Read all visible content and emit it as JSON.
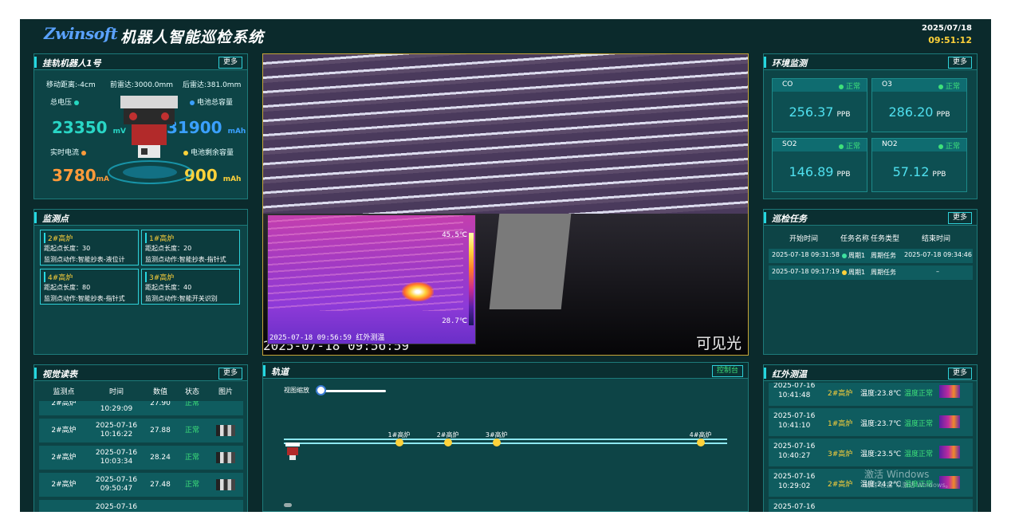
{
  "header": {
    "logo": "Zwinsoft",
    "title": "机器人智能巡检系统",
    "date": "2025/07/18",
    "time": "09:51:12"
  },
  "more_label": "更多",
  "robot": {
    "title": "挂轨机器人1号",
    "move": "移动距离:-4cm",
    "front": "前雷达:3000.0mm",
    "back": "后雷达:381.0mm",
    "voltage_label": "总电压",
    "voltage_value": "23350",
    "voltage_unit": "mV",
    "capacity_label": "电池总容量",
    "capacity_value": "31900",
    "capacity_unit": "mAh",
    "current_label": "实时电流",
    "current_value": "3780",
    "current_unit": "mA",
    "remain_label": "电池剩余容量",
    "remain_value": "900",
    "remain_unit": "mAh"
  },
  "monitor": {
    "title": "监测点",
    "points": [
      {
        "name": "2#高炉",
        "dist": "距起点长度：30",
        "action": "监测点动作:智能抄表-液位计"
      },
      {
        "name": "1#高炉",
        "dist": "距起点长度：20",
        "action": "监测点动作:智能抄表-指针式"
      },
      {
        "name": "4#高炉",
        "dist": "距起点长度：80",
        "action": "监测点动作:智能抄表-指针式"
      },
      {
        "name": "3#高炉",
        "dist": "距起点长度：40",
        "action": "监测点动作:智能开关识别"
      }
    ]
  },
  "visual": {
    "title": "视觉读表",
    "headers": [
      "监测点",
      "时间",
      "数值",
      "状态",
      "图片"
    ],
    "partial_top": {
      "name": "2#高炉",
      "time": "10:29:09",
      "value": "27.90",
      "status": "正常"
    },
    "rows": [
      {
        "name": "2#高炉",
        "date": "2025-07-16",
        "time": "10:16:22",
        "value": "27.88",
        "status": "正常"
      },
      {
        "name": "2#高炉",
        "date": "2025-07-16",
        "time": "10:03:34",
        "value": "28.24",
        "status": "正常"
      },
      {
        "name": "2#高炉",
        "date": "2025-07-16",
        "time": "09:50:47",
        "value": "27.48",
        "status": "正常"
      }
    ],
    "partial_bottom": {
      "date": "2025-07-16"
    }
  },
  "video": {
    "timestamp": "2025-07-18 09:56:59",
    "label": "可见光",
    "ir_timestamp": "2025-07-18 09:56:59",
    "ir_label": "红外测温",
    "ir_max": "45.5℃",
    "ir_min": "28.7℃"
  },
  "track": {
    "title": "轨道",
    "control": "控制台",
    "zoom_label": "视图缩放",
    "zoom_level": 0.05,
    "points": [
      {
        "name": "1#高炉",
        "pos": 0.26
      },
      {
        "name": "2#高炉",
        "pos": 0.37
      },
      {
        "name": "3#高炉",
        "pos": 0.48
      },
      {
        "name": "4#高炉",
        "pos": 0.94
      }
    ]
  },
  "env": {
    "title": "环境监测",
    "cards": [
      {
        "name": "CO",
        "status": "正常",
        "value": "256.37",
        "unit": "PPB"
      },
      {
        "name": "O3",
        "status": "正常",
        "value": "286.20",
        "unit": "PPB"
      },
      {
        "name": "SO2",
        "status": "正常",
        "value": "146.89",
        "unit": "PPB"
      },
      {
        "name": "NO2",
        "status": "正常",
        "value": "57.12",
        "unit": "PPB"
      }
    ]
  },
  "tasks": {
    "title": "巡检任务",
    "headers": [
      "开始时间",
      "任务名称",
      "任务类型",
      "结束时间"
    ],
    "rows": [
      {
        "start": "2025-07-18 09:31:58",
        "name": "周期1",
        "type": "周期任务",
        "end": "2025-07-18 09:34:46",
        "dot": "#3ee0a0"
      },
      {
        "start": "2025-07-18 09:17:19",
        "name": "周期1",
        "type": "周期任务",
        "end": "–",
        "dot": "#ffd23a"
      }
    ]
  },
  "ir": {
    "title": "红外测温",
    "partial_top": {
      "date": "2025-07-16",
      "time": "10:41:48",
      "name": "2#高炉",
      "temp": "温度:23.8℃",
      "status": "温度正常"
    },
    "rows": [
      {
        "date": "2025-07-16",
        "time": "10:41:10",
        "name": "1#高炉",
        "temp": "温度:23.7℃",
        "status": "温度正常"
      },
      {
        "date": "2025-07-16",
        "time": "10:40:27",
        "name": "3#高炉",
        "temp": "温度:23.5℃",
        "status": "温度正常"
      },
      {
        "date": "2025-07-16",
        "time": "10:29:02",
        "name": "2#高炉",
        "temp": "温度:24.2℃",
        "status": "温度正常"
      }
    ],
    "partial_bottom": {
      "date": "2025-07-16"
    }
  },
  "watermark": {
    "line1": "激活 Windows",
    "line2": "转到\"设置\"以激活 Windows。"
  }
}
